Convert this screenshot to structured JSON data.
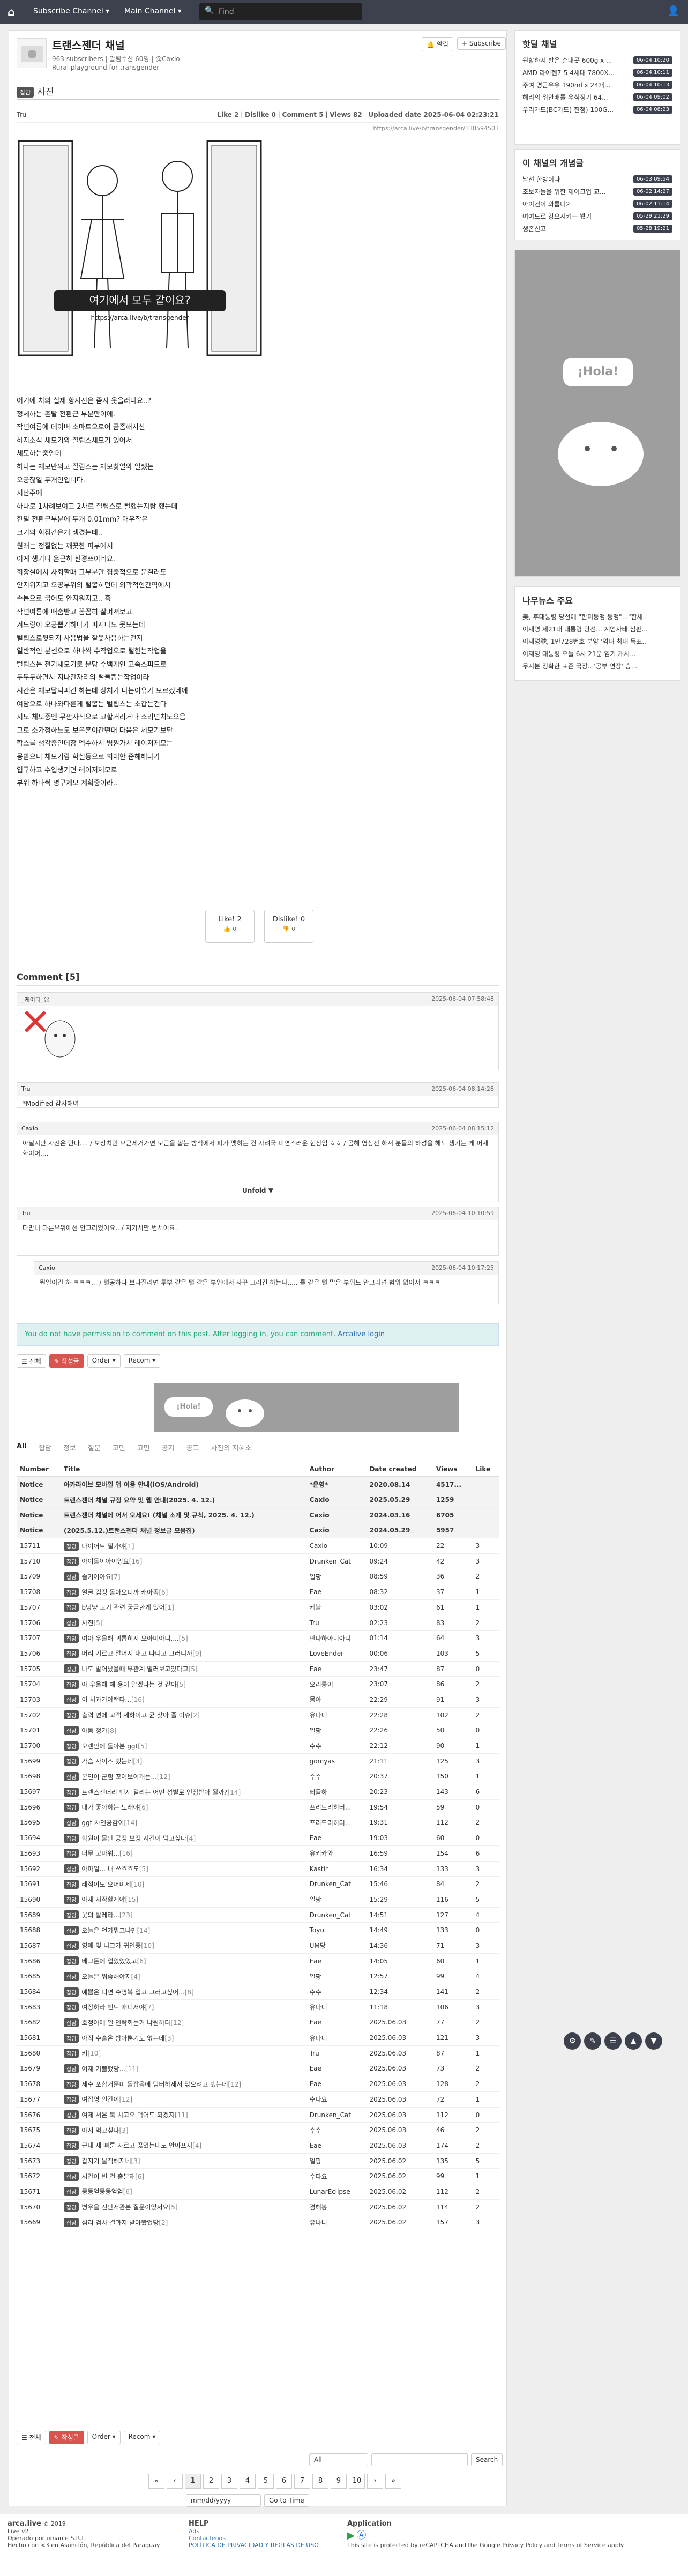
{
  "topbar": {
    "logo": "⌂",
    "subscribe": "Subscribe Channel ▾",
    "main": "Main Channel ▾",
    "search_placeholder": "Find",
    "user": "👤"
  },
  "channel": {
    "title": "트랜스젠더 채널",
    "subs": "963 subscribers | 알림수신 60명 | @Caxio",
    "desc": "Rural playground for transgender",
    "notify": "🔔 알림",
    "subscribe": "+ Subscribe"
  },
  "post": {
    "category": "잡담",
    "title": "사진",
    "author": "Tru",
    "likes": "Like 2",
    "dislikes": "Dislike 0",
    "comments": "Comment 5",
    "views": "Views 82",
    "uploaded": "Uploaded date 2025-06-04 02:23:21",
    "url": "https://arca.live/b/transgender/138594503",
    "illus_text": "여기에서 모두 같이요?",
    "illus_sub": "https://arca.live/b/transgender",
    "body": [
      "어기에 처의 실제 항사진은 좀시 웃을러나요..?",
      "정체하는 존탈 전환근 부분만이에.",
      "작년여름에 데이버 소마트으로어 곰좀해서신",
      "하지소식 체모기와 질립스체모기 있어서",
      "체모하는중인데",
      "하나는 체모반의고 질립스는 체모찾얼와 일쨌는",
      "오공찮일 두개인입니다.",
      "지난주에",
      "하나로 1차례보여고 2차로 질립스로 털했는지랑 했는데",
      "한필 전환근부분에 두개 0.01mm? 애우작은",
      "크기의 회점같은게 생겼는데..",
      "원래는 정질없는 깨끗한 피부에서",
      "이게 생기니 은근히 신경쓰이네요.",
      "회장실에서 사회할때 그부분만 집중적으로 문질러도",
      "안지워지고 오공부위의 털뽑히던데 외곽적인간역에서",
      "손톱으로 긁어도 안지워지고.. 흠",
      "작년여름에 배숨받고 꼼꼼히 살펴셔보고",
      "겨드랑이 오공쁩기하다가 피지나도 못보는데",
      "털립스로뒷되지 사용법을 잘못사용하는건지",
      "일반적인 분센으로 하나씩 수작업으로 털한는작업을",
      "털립스는 전기체모기로 분당 수백개인 고속스피드로",
      "두두두하면서 지나간자리의 털들뽑는작업이라",
      "시간은 체모달덕피긴 하는데 상처가 나는이유가 모르겠네에",
      "여담으로 하나와다른게 털뽑는 털립스는 소갑는건다",
      "지도 체모중엔 무짠자직으로 코할거리거나 소리년치도오음",
      "그로 소가정하느도 보은혼이간떤대 다음은 체모기보단",
      "학스를 생각중인데장 엑수하서 병원가서 레이저제모는",
      "몽받으니 체모기랑 학실등으로 회대한 준해해다가",
      "입구하고 수입생기면 레이저제모로",
      "부위 하나씩 명구제모 계획중이라.."
    ],
    "like_btn": "Like! 2",
    "like_sub": "👍 0",
    "dislike_btn": "Dislike! 0",
    "dislike_sub": "👎 0"
  },
  "comments_header": "Comment [5]",
  "comments": [
    {
      "author": "_케이디_☺",
      "date": "2025-06-04 07:58:48",
      "body": "(sticker)"
    },
    {
      "author": "Tru",
      "date": "2025-06-04 08:14:28",
      "body": "*Modified 감사해여"
    },
    {
      "author": "Caxio",
      "date": "2025-06-04 08:15:12",
      "body": "아닐지만 사진은 안다.... / 보상치인 모근제거가면 모근을 뽑는 방식에서 피가 맺히는 건 자려국 피연스러운 현상임 ㅎㅎ / 곰해 영상진 하서 분들의 하성을 해도 생기는 게 퍼재화이어....",
      "unfold": "Unfold ▼"
    },
    {
      "author": "Tru",
      "date": "2025-06-04 10:10:59",
      "body": "다만니 다른부위에선 안그러었어요.. / 저기서만 번서이요.."
    },
    {
      "author": "Caxio",
      "date": "2025-06-04 10:17:25",
      "body": "뭔일이긴 하 ㅋㅋㅋ... / 털공하나 보라질리면 투뿌 같은 털 같은 부위에서 자꾸 그러긴 하는다..... 를 같은 털 말은 부위도 안그러면 범위 없어서 ㅋㅋㅋ"
    }
  ],
  "no_perm": "You do not have permission to comment on this post. After logging in, you can comment.",
  "no_perm_link": "Arcalive login",
  "toolbar": {
    "list": "☰ 전체",
    "write": "✎ 작성글",
    "order": "Order ▾",
    "recom": "Recom ▾"
  },
  "ad_text": "¡Hola!",
  "tabs": [
    "All",
    "잡담",
    "정보",
    "질문",
    "고민",
    "고민",
    "공지",
    "공포",
    "사진의 지혜소"
  ],
  "table_headers": [
    "Number",
    "Title",
    "Author",
    "Date created",
    "Views",
    "Like"
  ],
  "notices": [
    [
      "Notice",
      "아카라이브 모바일 앱 이용 안내(iOS/Android)",
      "*운영*",
      "2020.08.14",
      "4517...",
      ""
    ],
    [
      "Notice",
      "트랜스젠더 채널 규정 요약 및 웹 안내(2025. 4. 12.)",
      "Caxio",
      "2025.05.29",
      "1259",
      ""
    ],
    [
      "Notice",
      "트랜스젠더 채널에 어서 오세요! (채널 소개 및 규칙, 2025. 4. 12.)",
      "Caxio",
      "2024.03.16",
      "6705",
      ""
    ],
    [
      "Notice",
      "(2025.5.12.)트랜스젠더 채널 정보글 모음집)",
      "Caxio",
      "2024.05.29",
      "5957",
      ""
    ]
  ],
  "rows": [
    [
      "15711",
      "잡담",
      "다이어트 필가야",
      "[1]",
      "Caxio",
      "10:09",
      "22",
      "3"
    ],
    [
      "15710",
      "잡담",
      "아이돌이아이잉요",
      "[16]",
      "Drunken_Cat",
      "09:24",
      "42",
      "3"
    ],
    [
      "15709",
      "잡담",
      "졸기어아요",
      "[7]",
      "일팡",
      "08:59",
      "36",
      "2"
    ],
    [
      "15708",
      "잡담",
      "얼굴 검정 돌아오니까 캐아좀",
      "[6]",
      "Eae",
      "08:32",
      "37",
      "1"
    ],
    [
      "15707",
      "잡담",
      "b닝냥 고기 관련 궁금한게 있어",
      "[1]",
      "케블",
      "03:02",
      "61",
      "1"
    ],
    [
      "15706",
      "잡담",
      "사진",
      "[5]",
      "Tru",
      "02:23",
      "83",
      "2"
    ],
    [
      "15707",
      "잡담",
      "여아 우울해 괴롭히지 오아미아니....",
      "[5]",
      "판다하아미아니",
      "01:14",
      "64",
      "3"
    ],
    [
      "15706",
      "잡담",
      "머리 기르고 알머시 내고 다니고 그러니까",
      "[9]",
      "LoveEnder",
      "00:06",
      "103",
      "5"
    ],
    [
      "15705",
      "잡담",
      "나도 발어났을때 무관계 멀러보고있다고",
      "[5]",
      "Eae",
      "23:47",
      "87",
      "0"
    ],
    [
      "15704",
      "잡담",
      "아 우울해 해 용어 알겠다는 것 같아",
      "[5]",
      "오리콩이",
      "23:07",
      "86",
      "2"
    ],
    [
      "15703",
      "잡담",
      "이 치과가야랜다...",
      "[16]",
      "몸아",
      "22:29",
      "91",
      "3"
    ],
    [
      "15702",
      "잡담",
      "출력 면에 고객 제하이고 균 찾아 줄 이슈",
      "[2]",
      "유나니",
      "22:28",
      "102",
      "2"
    ],
    [
      "15701",
      "잡담",
      "아돔 정가",
      "[8]",
      "일팡",
      "22:26",
      "50",
      "0"
    ],
    [
      "15700",
      "잡담",
      "오랜만에 돌아본 ggt",
      "[5]",
      "수수",
      "22:12",
      "90",
      "1"
    ],
    [
      "15699",
      "잡담",
      "가슴 사이즈 했는데",
      "[3]",
      "gomyas",
      "21:11",
      "125",
      "3"
    ],
    [
      "15698",
      "잡담",
      "본인이 군힘 꼬어보이개는...",
      "[12]",
      "수수",
      "20:37",
      "150",
      "1"
    ],
    [
      "15697",
      "잡담",
      "트랜스젠더리 밴지 걸리는 어떤 성별로 인정받아 될까?",
      "[14]",
      "빠들하",
      "20:23",
      "143",
      "6"
    ],
    [
      "15696",
      "잡담",
      "내가 좋아하는 노래야",
      "[6]",
      "프리드리히터...",
      "19:54",
      "59",
      "0"
    ],
    [
      "15695",
      "잡담",
      "ggt 사연공감이",
      "[14]",
      "프리드리히터...",
      "19:31",
      "112",
      "2"
    ],
    [
      "15694",
      "잡담",
      "학원이 물단 공정 보정 지킨이 먹고싶다",
      "[4]",
      "Eae",
      "19:03",
      "60",
      "0"
    ],
    [
      "15693",
      "잡담",
      "너무 고마워...",
      "[16]",
      "유키카와",
      "16:59",
      "154",
      "6"
    ],
    [
      "15692",
      "잡담",
      "아파일... 내 쓰흐흐도",
      "[5]",
      "Kastir",
      "16:34",
      "133",
      "3"
    ],
    [
      "15691",
      "잡담",
      "레점이도 오머미세",
      "[10]",
      "Drunken_Cat",
      "15:46",
      "84",
      "2"
    ],
    [
      "15690",
      "잡담",
      "아제 시작할게야",
      "[15]",
      "일팡",
      "15:29",
      "116",
      "5"
    ],
    [
      "15689",
      "잡담",
      "웃의 탈레라...",
      "[23]",
      "Drunken_Cat",
      "14:51",
      "127",
      "4"
    ],
    [
      "15688",
      "잡담",
      "오늘은 언가뭐고나면",
      "[14]",
      "Toyu",
      "14:49",
      "133",
      "0"
    ],
    [
      "15687",
      "잡담",
      "영메 및 니크가 귀인증",
      "[10]",
      "UM당",
      "14:36",
      "71",
      "3"
    ],
    [
      "15686",
      "잡담",
      "베그돈에 업었었었고",
      "[6]",
      "Eae",
      "14:05",
      "60",
      "1"
    ],
    [
      "15685",
      "잡담",
      "오늘은 뭐좋해야지",
      "[4]",
      "일팡",
      "12:57",
      "99",
      "4"
    ],
    [
      "15684",
      "잡담",
      "예쁨은 띠면 수영복 입고 그러고싶어...",
      "[8]",
      "수수",
      "12:34",
      "141",
      "2"
    ],
    [
      "15683",
      "잡담",
      "여장하라 밴드 매니저야",
      "[7]",
      "유나니",
      "11:18",
      "106",
      "3"
    ],
    [
      "15682",
      "잡담",
      "호정아에 일 인락회는거 냐뭔하다",
      "[12]",
      "Eae",
      "2025.06.03",
      "77",
      "2"
    ],
    [
      "15681",
      "잡담",
      "아직 수술은 방아뿐기도 없는데",
      "[3]",
      "유나니",
      "2025.06.03",
      "121",
      "3"
    ],
    [
      "15680",
      "잡담",
      "키",
      "[10]",
      "Tru",
      "2025.06.03",
      "87",
      "1"
    ],
    [
      "15679",
      "잡담",
      "여제 기쁠했당...",
      "[11]",
      "Eae",
      "2025.06.03",
      "73",
      "2"
    ],
    [
      "15678",
      "잡담",
      "세수 포합거문미 돌잡음에 팀터하세서 닦으려고 했는데",
      "[12]",
      "Eae",
      "2025.06.03",
      "128",
      "2"
    ],
    [
      "15677",
      "잡담",
      "여잡영 인간이",
      "[12]",
      "수다요",
      "2025.06.03",
      "72",
      "1"
    ],
    [
      "15676",
      "잡담",
      "여제 서온 북 치고오 먹어도 되겠지",
      "[11]",
      "Drunken_Cat",
      "2025.06.03",
      "112",
      "0"
    ],
    [
      "15675",
      "잡담",
      "아서 먹고싶다",
      "[3]",
      "수수",
      "2025.06.03",
      "46",
      "2"
    ],
    [
      "15674",
      "잡담",
      "근데 제 빠룬 자르고 끓었는데도 안아프지",
      "[4]",
      "Eae",
      "2025.06.03",
      "174",
      "2"
    ],
    [
      "15673",
      "잡담",
      "갑지기 울적해지네",
      "[3]",
      "일팡",
      "2025.06.02",
      "135",
      "5"
    ],
    [
      "15672",
      "잡담",
      "시간이 빈 건 출분재",
      "[6]",
      "수다요",
      "2025.06.02",
      "99",
      "1"
    ],
    [
      "15671",
      "잡담",
      "뭉둥얻뭉둥얻얻",
      "[6]",
      "LunarEclipse",
      "2025.06.02",
      "112",
      "2"
    ],
    [
      "15670",
      "잡담",
      "병우을 진단서관본 질문이었서요",
      "[5]",
      "경해봉",
      "2025.06.02",
      "114",
      "2"
    ],
    [
      "15669",
      "잡담",
      "심리 검사 결과지 받아봤었당",
      "[2]",
      "유나니",
      "2025.06.02",
      "157",
      "3"
    ]
  ],
  "pager": [
    "«",
    "‹",
    "1",
    "2",
    "3",
    "4",
    "5",
    "6",
    "7",
    "8",
    "9",
    "10",
    "›",
    "»"
  ],
  "search": {
    "scope": "All",
    "button": "Search",
    "date_placeholder": "mm/dd/yyyy",
    "goto": "Go to Time"
  },
  "sidebar": {
    "title1": "핫딜 채널",
    "hot": [
      [
        "원할하시 발은 손대곳 600g x ...",
        "06-04 10:20"
      ],
      [
        "AMD 라이젠7-5 4세대 7800X...",
        "06-04 10:11"
      ],
      [
        "주여 명군우유 190ml x 24개...",
        "06-04 10:13"
      ],
      [
        "해리의 위안배를 유식정기 64...",
        "06-04 09:02"
      ],
      [
        "우리카드(BC카드) 진청) 100G...",
        "06-04 08:23"
      ]
    ],
    "title2": "이 채널의 개념글",
    "best": [
      [
        "낡선 한방이다",
        "06-03 09:54"
      ],
      [
        "조보자들을 위한 제이크업 교...",
        "06-02 14:27"
      ],
      [
        "아이컨이 와릅니2",
        "06-02 11:14"
      ],
      [
        "여여도로 강요시키는 봤기",
        "05-29 21:29"
      ],
      [
        "생존신고",
        "05-28 19:21"
      ]
    ],
    "title3": "나무뉴스 주요",
    "news": [
      "美, 후대통령 당선에 \"한미동맹 동맹\"...\"한세...",
      "이재명 제21대 대통령 당선... 계엄사태 심판...",
      "이재명號, 1만728번호 분양 '역대 최대 득표...",
      "이재명 대통령 오늘 6시 21분 임기 개시...",
      "무지분 정확한 표준 국장...'공부 연장' 승..."
    ]
  },
  "footer": {
    "brand": "arca.live",
    "copy": "© 2019",
    "ver": "Live v2",
    "op": "Operado por umanle S.R.L.",
    "addr": "Hecho con <3 en Asunción, República del Paraguay",
    "help_t": "HELP",
    "help1": "Ads",
    "help2": "Contactenos",
    "help3": "POLÍTICA DE PRIVACIDAD Y REGLAS DE USO",
    "app_t": "Application",
    "recaptcha": "This site is protected by reCAPTCHA and the Google Privacy Policy and Terms of Service apply."
  }
}
